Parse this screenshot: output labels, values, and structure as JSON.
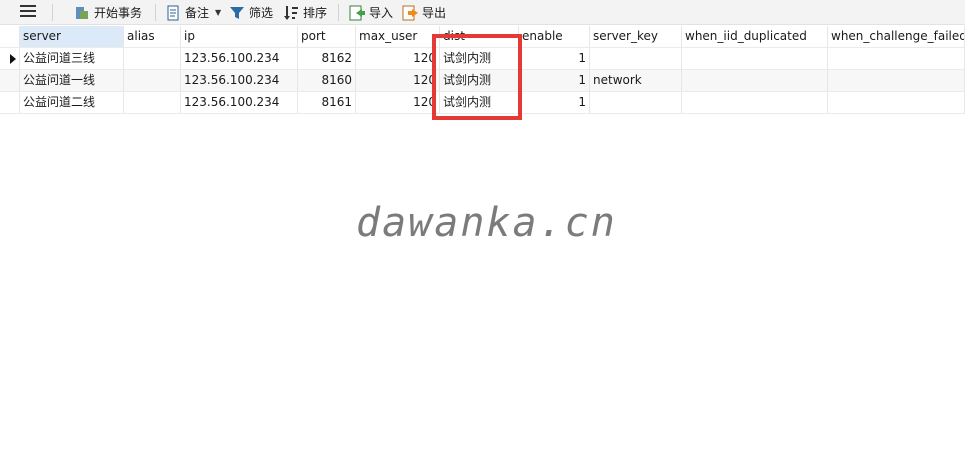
{
  "toolbar": {
    "begin_transaction": "开始事务",
    "memo": "备注",
    "filter": "筛选",
    "sort": "排序",
    "import": "导入",
    "export": "导出"
  },
  "table": {
    "columns": [
      "server",
      "alias",
      "ip",
      "port",
      "max_user",
      "dist",
      "enable",
      "server_key",
      "when_iid_duplicated",
      "when_challenge_failed"
    ],
    "rows": [
      [
        "公益问道三线",
        "",
        "123.56.100.234",
        "8162",
        "120",
        "试剑内测",
        "1",
        "",
        "",
        ""
      ],
      [
        "公益问道一线",
        "",
        "123.56.100.234",
        "8160",
        "120",
        "试剑内测",
        "1",
        "network",
        "",
        ""
      ],
      [
        "公益问道二线",
        "",
        "123.56.100.234",
        "8161",
        "120",
        "试剑内测",
        "1",
        "",
        "",
        ""
      ]
    ]
  },
  "watermark": "dawanka.cn",
  "colors": {
    "highlight": "#e53935",
    "selected_header": "#dbe9f8"
  },
  "icons": [
    "menu-icon",
    "begin-transaction-icon",
    "memo-icon",
    "filter-icon",
    "sort-icon",
    "import-icon",
    "export-icon"
  ]
}
